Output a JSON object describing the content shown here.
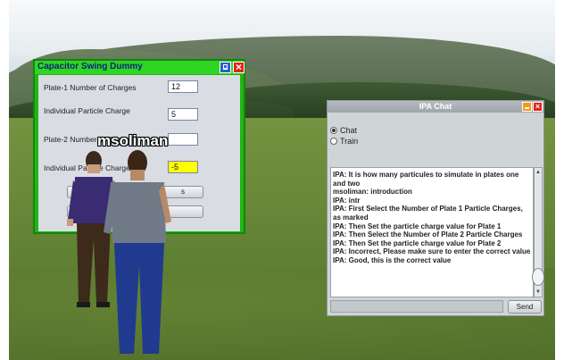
{
  "capacitor_panel": {
    "title": "Capacitor Swing Dummy",
    "fields": [
      {
        "label": "Plate-1 Number of Charges",
        "value": "12"
      },
      {
        "label": "Individual Particle Charge",
        "value": "5"
      },
      {
        "label": "Plate-2 Number of Charges",
        "value": ""
      },
      {
        "label": "Individual Particle Charge",
        "value": "-5"
      }
    ],
    "button_partial_label": "s",
    "highlight_color": "#ffff00",
    "accent_color": "#22b515"
  },
  "avatar": {
    "name": "msoliman"
  },
  "ipa_chat": {
    "title": "IPA Chat",
    "mode_options": [
      {
        "label": "Chat",
        "selected": true
      },
      {
        "label": "Train",
        "selected": false
      }
    ],
    "messages": [
      "IPA: It is how many particules to simulate in plates one and two",
      "msoliman: introduction",
      "IPA: intr",
      "IPA: First Select the Number of Plate 1 Particle Charges, as marked",
      "IPA: Then Set the particle charge value for Plate 1",
      "IPA: Then Select the Number of Plate 2 Particle Charges",
      "IPA: Then  Set the particle charge value for Plate 2",
      "IPA: Incorrect, Please make sure to enter the correct value",
      "IPA: Good, this is the correct value"
    ],
    "input_value": "",
    "send_label": "Send"
  }
}
